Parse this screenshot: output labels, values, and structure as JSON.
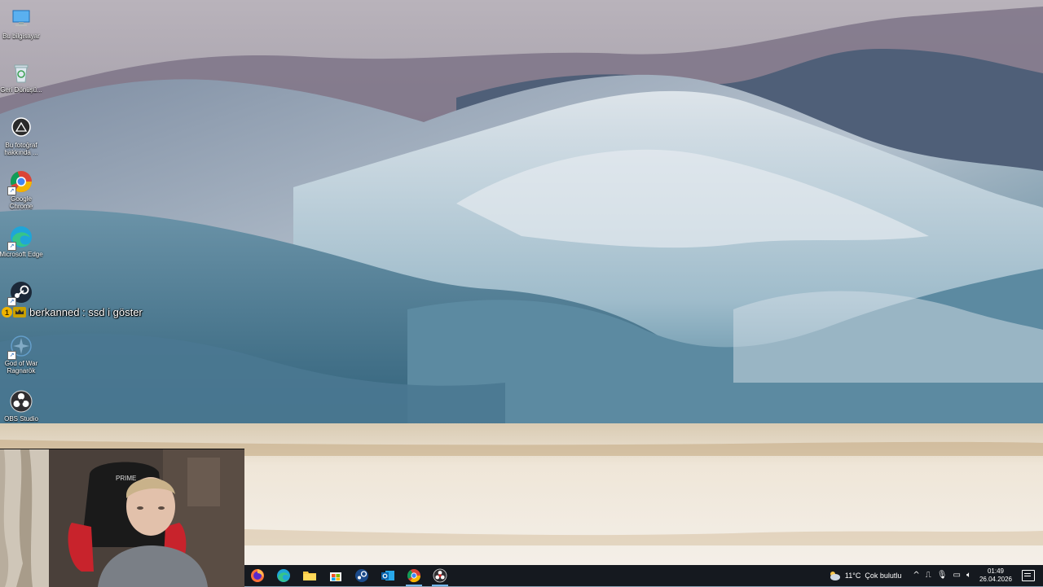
{
  "desktop": {
    "icons": [
      {
        "label": "Bu bilgisayar",
        "icon": "this-pc-icon"
      },
      {
        "label": "Geri Dönüşü...",
        "icon": "recycle-bin-icon"
      },
      {
        "label": "Bu fotoğraf hakkında ...",
        "icon": "about-photo-icon"
      },
      {
        "label": "Google Chrome",
        "icon": "chrome-icon"
      },
      {
        "label": "Microsoft Edge",
        "icon": "edge-icon"
      },
      {
        "label": "Steam",
        "icon": "steam-icon"
      },
      {
        "label": "God of War Ragnarök",
        "icon": "god-of-war-icon"
      },
      {
        "label": "OBS Studio",
        "icon": "obs-icon"
      }
    ]
  },
  "chat_overlay": {
    "badge_number": "1",
    "message": "berkanned : ssd i göster"
  },
  "webcam": {
    "chair_brand": "PRIME"
  },
  "taskbar": {
    "apps": [
      "firefox-icon",
      "edge-icon",
      "file-explorer-icon",
      "store-icon",
      "steam-icon",
      "outlook-icon",
      "chrome-icon",
      "obs-icon"
    ],
    "weather": {
      "temp": "11°C",
      "condition": "Çok bulutlu"
    },
    "clock": {
      "time": "01:49",
      "date": "26.04.2026"
    }
  },
  "colors": {
    "taskbar_bg": "#15191f",
    "accent": "#76b9ed"
  }
}
